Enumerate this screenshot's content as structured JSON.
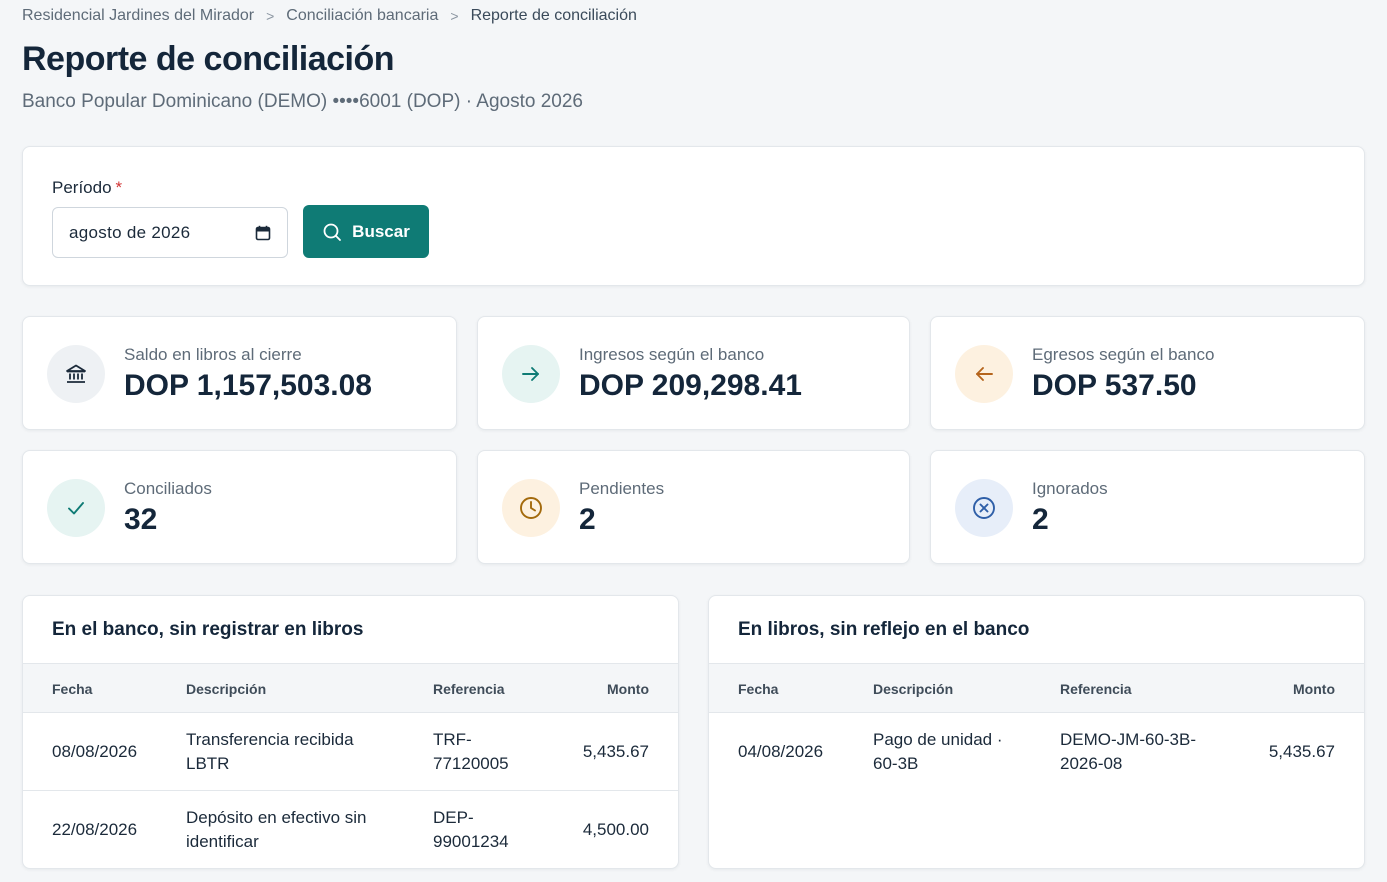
{
  "breadcrumb": [
    {
      "label": "Residencial Jardines del Mirador"
    },
    {
      "label": "Conciliación bancaria"
    },
    {
      "label": "Reporte de conciliación"
    }
  ],
  "page": {
    "title": "Reporte de conciliación",
    "subtitle": "Banco Popular Dominicano (DEMO) ••••6001 (DOP) · Agosto 2026"
  },
  "filter": {
    "period_label": "Período",
    "required_mark": "*",
    "period_value": "agosto de 2026",
    "search_label": "Buscar"
  },
  "stats": [
    {
      "label": "Saldo en libros al cierre",
      "value": "DOP 1,157,503.08",
      "icon": "bank-icon",
      "color": "#1b2a3a"
    },
    {
      "label": "Ingresos según el banco",
      "value": "DOP 209,298.41",
      "icon": "arrow-right-icon",
      "color": "#0f7b75"
    },
    {
      "label": "Egresos según el banco",
      "value": "DOP 537.50",
      "icon": "arrow-left-icon",
      "color": "#b5651d"
    },
    {
      "label": "Conciliados",
      "value": "32",
      "icon": "check-icon",
      "color": "#0f7b75"
    },
    {
      "label": "Pendientes",
      "value": "2",
      "icon": "clock-icon",
      "color": "#a36a0c"
    },
    {
      "label": "Ignorados",
      "value": "2",
      "icon": "x-circle-icon",
      "color": "#2f5fa8"
    }
  ],
  "bank_only": {
    "title": "En el banco, sin registrar en libros",
    "columns": [
      "Fecha",
      "Descripción",
      "Referencia",
      "Monto"
    ],
    "rows": [
      {
        "date": "08/08/2026",
        "desc1": "Transferencia recibida",
        "desc2": "LBTR",
        "ref1": "TRF-",
        "ref2": "77120005",
        "amount": "5,435.67"
      },
      {
        "date": "22/08/2026",
        "desc1": "Depósito en efectivo sin",
        "desc2": "identificar",
        "ref1": "DEP-",
        "ref2": "99001234",
        "amount": "4,500.00"
      }
    ]
  },
  "books_only": {
    "title": "En libros, sin reflejo en el banco",
    "columns": [
      "Fecha",
      "Descripción",
      "Referencia",
      "Monto"
    ],
    "rows": [
      {
        "date": "04/08/2026",
        "desc1": "Pago de unidad ·",
        "desc2": "60-3B",
        "ref1": "DEMO-JM-60-3B-",
        "ref2": "2026-08",
        "amount": "5,435.67"
      }
    ]
  }
}
